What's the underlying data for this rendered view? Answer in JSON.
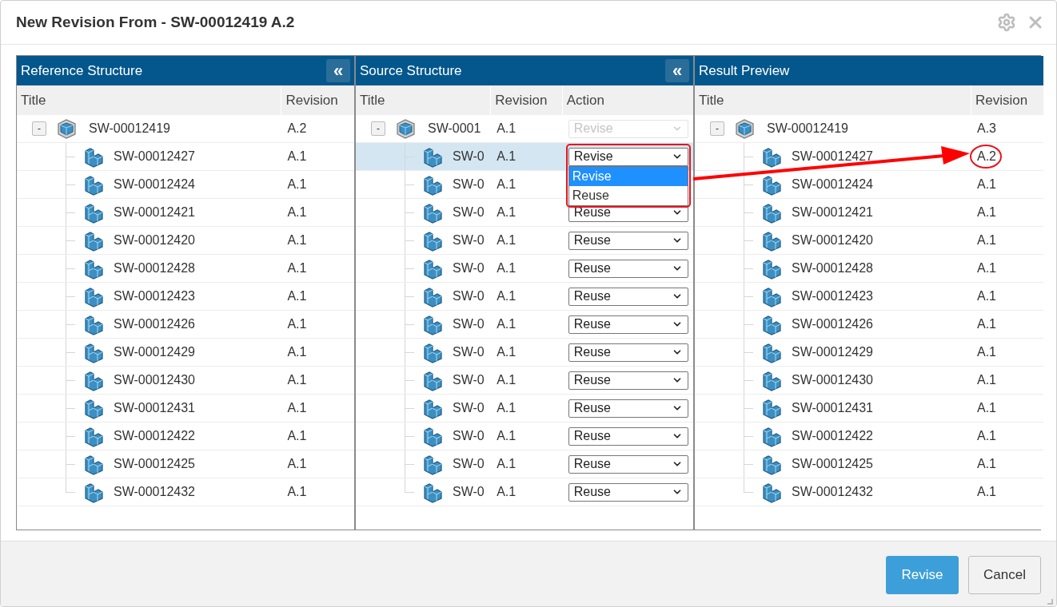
{
  "window": {
    "title": "New Revision From - SW-00012419 A.2"
  },
  "panels": [
    {
      "title": "Reference Structure",
      "collapse_button": "«",
      "columns": [
        "Title",
        "Revision"
      ],
      "root": {
        "title": "SW-00012419",
        "revision": "A.2",
        "expander": "-",
        "expanded": true,
        "selected": false,
        "children": [
          {
            "title": "SW-00012427",
            "revision": "A.1",
            "selected": false
          },
          {
            "title": "SW-00012424",
            "revision": "A.1",
            "selected": false
          },
          {
            "title": "SW-00012421",
            "revision": "A.1",
            "selected": false
          },
          {
            "title": "SW-00012420",
            "revision": "A.1",
            "selected": false
          },
          {
            "title": "SW-00012428",
            "revision": "A.1",
            "selected": false
          },
          {
            "title": "SW-00012423",
            "revision": "A.1",
            "selected": false
          },
          {
            "title": "SW-00012426",
            "revision": "A.1",
            "selected": false
          },
          {
            "title": "SW-00012429",
            "revision": "A.1",
            "selected": false
          },
          {
            "title": "SW-00012430",
            "revision": "A.1",
            "selected": false
          },
          {
            "title": "SW-00012431",
            "revision": "A.1",
            "selected": false
          },
          {
            "title": "SW-00012422",
            "revision": "A.1",
            "selected": false
          },
          {
            "title": "SW-00012425",
            "revision": "A.1",
            "selected": false
          },
          {
            "title": "SW-00012432",
            "revision": "A.1",
            "selected": false
          }
        ]
      }
    },
    {
      "title": "Source Structure",
      "collapse_button": "«",
      "columns": [
        "Title",
        "Revision",
        "Action"
      ],
      "root": {
        "title": "SW-0001",
        "revision": "A.1",
        "expander": "-",
        "expanded": true,
        "selected": false,
        "action": {
          "value": "Revise",
          "disabled": true
        },
        "children": [
          {
            "title": "SW-0",
            "revision": "A.1",
            "selected": true,
            "action": {
              "value": "Revise",
              "disabled": false,
              "options": [
                {
                  "label": "Revise",
                  "selected": true
                },
                {
                  "label": "Reuse",
                  "selected": false
                }
              ]
            }
          },
          {
            "title": "SW-0",
            "revision": "A.1",
            "selected": false
          },
          {
            "title": "SW-0",
            "revision": "A.1",
            "selected": false,
            "action": {
              "value": "Reuse",
              "disabled": false
            }
          },
          {
            "title": "SW-0",
            "revision": "A.1",
            "selected": false,
            "action": {
              "value": "Reuse",
              "disabled": false
            }
          },
          {
            "title": "SW-0",
            "revision": "A.1",
            "selected": false,
            "action": {
              "value": "Reuse",
              "disabled": false
            }
          },
          {
            "title": "SW-0",
            "revision": "A.1",
            "selected": false,
            "action": {
              "value": "Reuse",
              "disabled": false
            }
          },
          {
            "title": "SW-0",
            "revision": "A.1",
            "selected": false,
            "action": {
              "value": "Reuse",
              "disabled": false
            }
          },
          {
            "title": "SW-0",
            "revision": "A.1",
            "selected": false,
            "action": {
              "value": "Reuse",
              "disabled": false
            }
          },
          {
            "title": "SW-0",
            "revision": "A.1",
            "selected": false,
            "action": {
              "value": "Reuse",
              "disabled": false
            }
          },
          {
            "title": "SW-0",
            "revision": "A.1",
            "selected": false,
            "action": {
              "value": "Reuse",
              "disabled": false
            }
          },
          {
            "title": "SW-0",
            "revision": "A.1",
            "selected": false,
            "action": {
              "value": "Reuse",
              "disabled": false
            }
          },
          {
            "title": "SW-0",
            "revision": "A.1",
            "selected": false,
            "action": {
              "value": "Reuse",
              "disabled": false
            }
          },
          {
            "title": "SW-0",
            "revision": "A.1",
            "selected": false,
            "action": {
              "value": "Reuse",
              "disabled": false
            }
          }
        ]
      }
    },
    {
      "title": "Result Preview",
      "columns": [
        "Title",
        "Revision"
      ],
      "root": {
        "title": "SW-00012419",
        "revision": "A.3",
        "expander": "-",
        "expanded": true,
        "selected": false,
        "children": [
          {
            "title": "SW-00012427",
            "revision": "A.2",
            "selected": false
          },
          {
            "title": "SW-00012424",
            "revision": "A.1",
            "selected": false
          },
          {
            "title": "SW-00012421",
            "revision": "A.1",
            "selected": false
          },
          {
            "title": "SW-00012420",
            "revision": "A.1",
            "selected": false
          },
          {
            "title": "SW-00012428",
            "revision": "A.1",
            "selected": false
          },
          {
            "title": "SW-00012423",
            "revision": "A.1",
            "selected": false
          },
          {
            "title": "SW-00012426",
            "revision": "A.1",
            "selected": false
          },
          {
            "title": "SW-00012429",
            "revision": "A.1",
            "selected": false
          },
          {
            "title": "SW-00012430",
            "revision": "A.1",
            "selected": false
          },
          {
            "title": "SW-00012431",
            "revision": "A.1",
            "selected": false
          },
          {
            "title": "SW-00012422",
            "revision": "A.1",
            "selected": false
          },
          {
            "title": "SW-00012425",
            "revision": "A.1",
            "selected": false
          },
          {
            "title": "SW-00012432",
            "revision": "A.1",
            "selected": false
          }
        ]
      }
    }
  ],
  "buttons": [
    {
      "label": "Revise",
      "kind": "primary"
    },
    {
      "label": "Cancel",
      "kind": "secondary"
    }
  ]
}
